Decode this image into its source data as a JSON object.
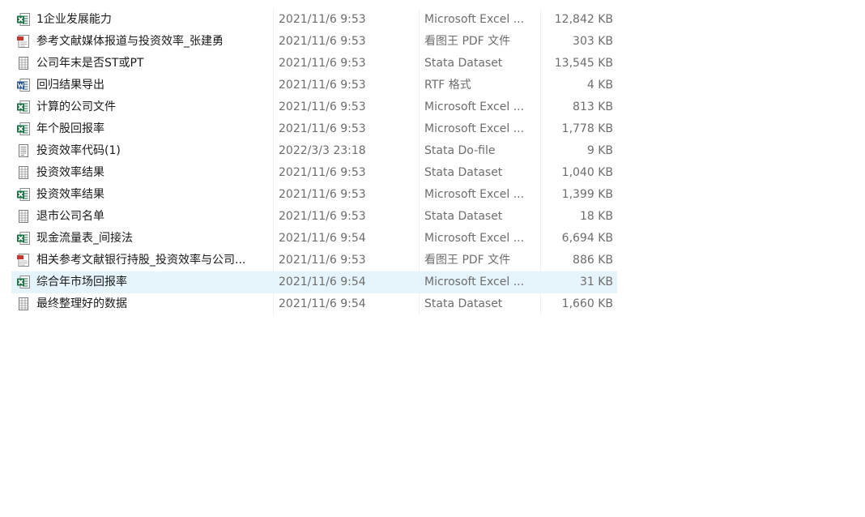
{
  "files": [
    {
      "name": "1企业发展能力",
      "date": "2021/11/6 9:53",
      "type": "Microsoft Excel ...",
      "size": "12,842 KB",
      "icon": "excel-icon",
      "selected": false
    },
    {
      "name": "参考文献媒体报道与投资效率_张建勇",
      "date": "2021/11/6 9:53",
      "type": "看图王 PDF 文件",
      "size": "303 KB",
      "icon": "pdf-icon",
      "selected": false
    },
    {
      "name": "公司年末是否ST或PT",
      "date": "2021/11/6 9:53",
      "type": "Stata Dataset",
      "size": "13,545 KB",
      "icon": "dataset-icon",
      "selected": false
    },
    {
      "name": "回归结果导出",
      "date": "2021/11/6 9:53",
      "type": "RTF 格式",
      "size": "4 KB",
      "icon": "word-icon",
      "selected": false
    },
    {
      "name": "计算的公司文件",
      "date": "2021/11/6 9:53",
      "type": "Microsoft Excel ...",
      "size": "813 KB",
      "icon": "excel-icon",
      "selected": false
    },
    {
      "name": "年个股回报率",
      "date": "2021/11/6 9:53",
      "type": "Microsoft Excel ...",
      "size": "1,778 KB",
      "icon": "excel-icon",
      "selected": false
    },
    {
      "name": "投资效率代码(1)",
      "date": "2022/3/3 23:18",
      "type": "Stata Do-file",
      "size": "9 KB",
      "icon": "text-file-icon",
      "selected": false
    },
    {
      "name": "投资效率结果",
      "date": "2021/11/6 9:53",
      "type": "Stata Dataset",
      "size": "1,040 KB",
      "icon": "dataset-icon",
      "selected": false
    },
    {
      "name": "投资效率结果",
      "date": "2021/11/6 9:53",
      "type": "Microsoft Excel ...",
      "size": "1,399 KB",
      "icon": "excel-icon",
      "selected": false
    },
    {
      "name": "退市公司名单",
      "date": "2021/11/6 9:53",
      "type": "Stata Dataset",
      "size": "18 KB",
      "icon": "dataset-icon",
      "selected": false
    },
    {
      "name": "现金流量表_间接法",
      "date": "2021/11/6 9:54",
      "type": "Microsoft Excel ...",
      "size": "6,694 KB",
      "icon": "excel-icon",
      "selected": false
    },
    {
      "name": "相关参考文献银行持股_投资效率与公司...",
      "date": "2021/11/6 9:53",
      "type": "看图王 PDF 文件",
      "size": "886 KB",
      "icon": "pdf-icon",
      "selected": false
    },
    {
      "name": "综合年市场回报率",
      "date": "2021/11/6 9:54",
      "type": "Microsoft Excel ...",
      "size": "31 KB",
      "icon": "excel-icon",
      "selected": true
    },
    {
      "name": "最终整理好的数据",
      "date": "2021/11/6 9:54",
      "type": "Stata Dataset",
      "size": "1,660 KB",
      "icon": "dataset-icon",
      "selected": false
    }
  ],
  "colors": {
    "selected_bg": "#e5f3fb",
    "excel_green": "#1e7145",
    "word_blue": "#2b5797",
    "pdf_red": "#c8372d",
    "secondary_text": "#6d6d6d"
  }
}
